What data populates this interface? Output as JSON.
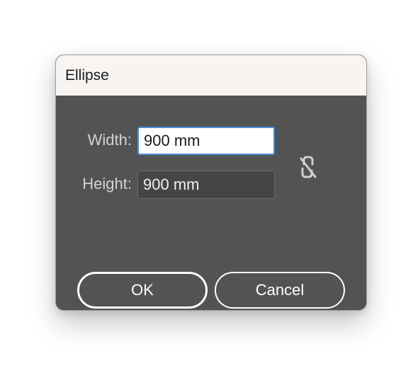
{
  "dialog": {
    "title": "Ellipse",
    "width_label": "Width:",
    "width_value": "900 mm",
    "height_label": "Height:",
    "height_value": "900 mm",
    "constrain_icon": "unlinked-chain-icon",
    "ok_label": "OK",
    "cancel_label": "Cancel"
  },
  "colors": {
    "titlebar": "#f7f4f2",
    "body": "#535353",
    "focus_border": "#4b8fd8"
  }
}
